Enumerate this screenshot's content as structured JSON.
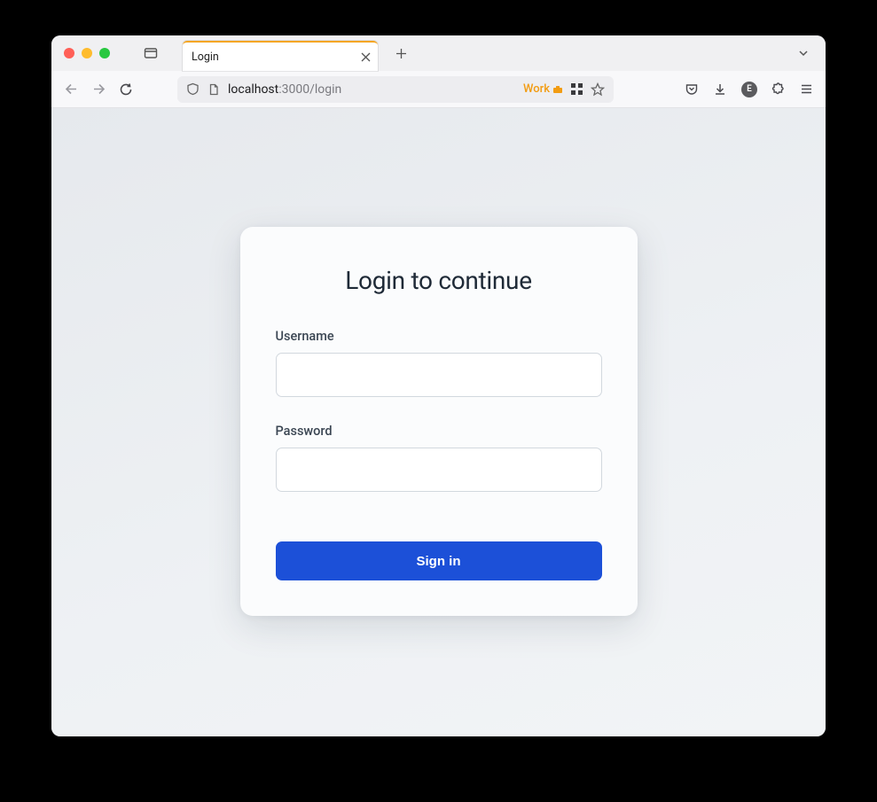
{
  "browser": {
    "tab_title": "Login",
    "url_host": "localhost",
    "url_rest": ":3000/login",
    "container_label": "Work",
    "extension_badge_text": "E"
  },
  "login": {
    "heading": "Login to continue",
    "username_label": "Username",
    "username_value": "",
    "password_label": "Password",
    "password_value": "",
    "submit_label": "Sign in"
  }
}
